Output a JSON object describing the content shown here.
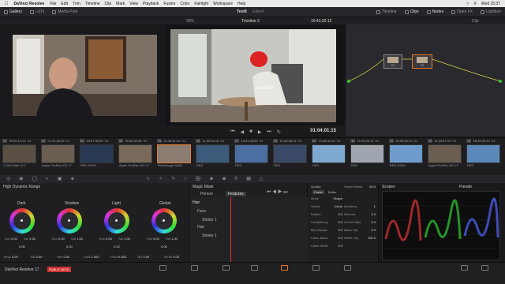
{
  "menubar": {
    "app": "DaVinci Resolve",
    "items": [
      "File",
      "Edit",
      "Trim",
      "Timeline",
      "Clip",
      "Mark",
      "View",
      "Playback",
      "Fusion",
      "Color",
      "Fairlight",
      "Workspace",
      "Help"
    ],
    "clock": "Wed 15:37"
  },
  "topbar": {
    "left": [
      "Gallery",
      "LUTs",
      "Media Pool"
    ],
    "project": "Test9",
    "edited": "Edited",
    "right": [
      "Timeline",
      "Clips",
      "Nodes",
      "Open FX",
      "Lightbox"
    ]
  },
  "viewerbar": {
    "zoom": "33%",
    "timeline": "Timeline 2",
    "timecode": "10:41:32:12",
    "mode": "Clip"
  },
  "viewer": {
    "timecode": "01:04:01:15"
  },
  "nodes": [
    {
      "num": "01"
    },
    {
      "num": "02"
    }
  ],
  "clips": [
    {
      "num": "01",
      "tc": "00:00:14:14",
      "track": "V1",
      "label": "H.264 High L5.1"
    },
    {
      "num": "02",
      "tc": "01:01:25:05",
      "track": "V1",
      "label": "Apple ProRes 422 LT"
    },
    {
      "num": "03",
      "tc": "00:37:00:00",
      "track": "V1",
      "label": "RED HDRx"
    },
    {
      "num": "04",
      "tc": "09:58:30:05",
      "track": "V1",
      "label": "Apple ProRes 422 LT"
    },
    {
      "num": "05",
      "tc": "11:40:41:22",
      "track": "V1",
      "label": "Blackmagic RAW"
    },
    {
      "num": "06",
      "tc": "11:52:04:18",
      "track": "V1",
      "label": "RED"
    },
    {
      "num": "07",
      "tc": "12:31:25:05",
      "track": "V1",
      "label": "RED"
    },
    {
      "num": "08",
      "tc": "12:46:36:11",
      "track": "V1",
      "label": "RED"
    },
    {
      "num": "09",
      "tc": "13:46:44:16",
      "track": "V1",
      "label": "RED"
    },
    {
      "num": "10",
      "tc": "15:18:29:12",
      "track": "V1",
      "label": "RED"
    },
    {
      "num": "11",
      "tc": "16:05:26:21",
      "track": "V1",
      "label": "RED HDRx"
    },
    {
      "num": "12",
      "tc": "11:34:57:22",
      "track": "V1",
      "label": "Apple ProRes 422 LT"
    },
    {
      "num": "13",
      "tc": "18:39:23:13",
      "track": "V1",
      "label": "RED"
    }
  ],
  "wheels_panel": {
    "title": "High Dynamic Range",
    "wheels": [
      {
        "name": "Dark",
        "exp": "0.00",
        "sat": "1.00",
        "val": "0.00"
      },
      {
        "name": "Shadow",
        "exp": "0.00",
        "sat": "1.00",
        "val": "0.20"
      },
      {
        "name": "Light",
        "exp": "0.00",
        "sat": "1.00",
        "val": "0.22"
      },
      {
        "name": "Global",
        "exp": "0.00",
        "sat": "1.00",
        "val": "0.00"
      }
    ],
    "bottom": [
      {
        "k": "Temp",
        "v": "0.00"
      },
      {
        "k": "Tint",
        "v": "0.00"
      },
      {
        "k": "Hue",
        "v": "0.00"
      },
      {
        "k": "Cont",
        "v": "1.000"
      },
      {
        "k": "Pivot",
        "v": "0.000"
      },
      {
        "k": "MD",
        "v": "0.00"
      },
      {
        "k": "B/Ofs",
        "v": "0.00"
      }
    ]
  },
  "mask": {
    "title": "Magic Mask",
    "tabs": [
      "Person",
      "Features"
    ],
    "tracks": [
      "Hair",
      "Face",
      "Stroke 1",
      "Hair",
      "Stroke 1"
    ]
  },
  "quality": {
    "title": "Quality",
    "modes": [
      "Faster",
      "Better"
    ],
    "rows": [
      {
        "k": "Mode",
        "v": "Shape"
      },
      {
        "k": "Shrink",
        "v": "Circle"
      },
      {
        "k": "Radius",
        "v": "0.0"
      },
      {
        "k": "Consistency",
        "v": "0.0"
      },
      {
        "k": "Blur Radius",
        "v": "0.0"
      },
      {
        "k": "Clean Black",
        "v": "0.0"
      },
      {
        "k": "Clean White",
        "v": "0.0"
      }
    ],
    "right_rows": [
      {
        "k": "Smart Refine",
        "v": "50.0"
      },
      {
        "k": "Iterations",
        "v": "1"
      },
      {
        "k": "Denoise",
        "v": "0.0"
      },
      {
        "k": "In/Out Ratio",
        "v": "0.0"
      },
      {
        "k": "Black Clip",
        "v": "0.0"
      },
      {
        "k": "White Clip",
        "v": "100.0"
      }
    ]
  },
  "scopes": {
    "title": "Scopes",
    "mode": "Parade"
  },
  "dock": {
    "app": "DaVinci Resolve 17",
    "badge": "PUBLIC BETA"
  }
}
